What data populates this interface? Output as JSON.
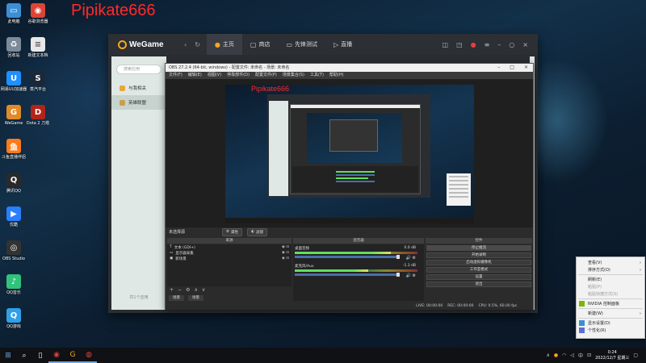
{
  "watermark": "Pipikate666",
  "desktop_icons": [
    {
      "label": "此电脑",
      "icon": "computer-icon",
      "color": "#3b8fd6"
    },
    {
      "label": "回收站",
      "icon": "recycle-bin-icon",
      "color": "#7c8a99"
    },
    {
      "label": "网易UU加速器",
      "icon": "uu-accelerator-icon",
      "color": "#1e90ff"
    },
    {
      "label": "WeGame",
      "icon": "wegame-icon",
      "color": "#e08a2a"
    },
    {
      "label": "斗鱼直播伴侣",
      "icon": "douyu-icon",
      "color": "#ff7a1a"
    },
    {
      "label": "腾讯QQ",
      "icon": "qq-icon",
      "color": "#2a2a2a"
    },
    {
      "label": "优酷",
      "icon": "youku-icon",
      "color": "#2a7fff"
    },
    {
      "label": "OBS Studio",
      "icon": "obs-icon",
      "color": "#333333"
    },
    {
      "label": "QQ音乐",
      "icon": "qq-music-icon",
      "color": "#31c27c"
    },
    {
      "label": "QQ游戏",
      "icon": "qq-game-icon",
      "color": "#2fa0e8"
    },
    {
      "label": "谷歌浏览器",
      "icon": "chrome-icon",
      "color": "#db4437"
    },
    {
      "label": "新建文本档",
      "icon": "text-file-icon",
      "color": "#e8e8e8"
    },
    {
      "label": "蒸汽平台",
      "icon": "steam-icon",
      "color": "#1b2838"
    },
    {
      "label": "Dota 2 刀塔",
      "icon": "dota2-icon",
      "color": "#b32418"
    }
  ],
  "wegame": {
    "logo": "WeGame",
    "tabs": [
      {
        "label": "主页",
        "icon": "home-icon"
      },
      {
        "label": "商店",
        "icon": "store-icon"
      },
      {
        "label": "先锋测试",
        "icon": "test-icon"
      },
      {
        "label": "直播",
        "icon": "live-icon"
      }
    ],
    "search_placeholder": "搜索应用",
    "side_items": [
      "与我相关",
      "英雄联盟"
    ],
    "side_bottom": "共1个应用"
  },
  "obs": {
    "title": "OBS 27.2.4 (64-bit, windows) - 配置文件: 未命名 - 场景: 未命名",
    "menu": [
      "文件(F)",
      "编辑(E)",
      "视图(V)",
      "停靠部件(D)",
      "配置文件(P)",
      "场景集合(S)",
      "工具(T)",
      "帮助(H)"
    ],
    "scene_label": "未选择源",
    "props_btn": "属性",
    "filters_btn": "滤镜",
    "sources_header": "来源",
    "sources": [
      {
        "glyph": "T",
        "name": "文本 (GDI+)"
      },
      {
        "glyph": "▭",
        "name": "显示器采集"
      },
      {
        "glyph": "▣",
        "name": "新场景"
      }
    ],
    "mixer_header": "混音器",
    "mixer": [
      {
        "name": "桌面音频",
        "db": "0.0 dB",
        "level": 0.78
      },
      {
        "name": "麦克风/Aux",
        "db": "-1.3 dB",
        "level": 0.6
      }
    ],
    "controls_header": "控件",
    "controls": [
      "停止推流",
      "开始录制",
      "启动虚拟摄像机",
      "工作室模式",
      "设置",
      "退出"
    ],
    "dock_tabs": [
      "场景",
      "场景"
    ],
    "transitions_tab": "转场特效",
    "mixer_tab": "混音器",
    "status": {
      "live": "LIVE: 00:00:00",
      "rec": "REC: 00:00:00",
      "cpu": "CPU: 0.5%, 60.00 fps"
    }
  },
  "context_menu": [
    {
      "label": "查看(V)",
      "disabled": false,
      "arrow": true
    },
    {
      "label": "排序方式(O)",
      "disabled": false,
      "arrow": true
    },
    {
      "label": "刷新(E)",
      "disabled": false,
      "arrow": false
    },
    {
      "label": "粘贴(P)",
      "disabled": true,
      "arrow": false
    },
    {
      "label": "粘贴快捷方式(S)",
      "disabled": true,
      "arrow": false
    },
    {
      "label": "NVIDIA 控制面板",
      "disabled": false,
      "arrow": false
    },
    {
      "label": "新建(W)",
      "disabled": false,
      "arrow": true
    },
    {
      "label": "显示设置(D)",
      "disabled": false,
      "arrow": false
    },
    {
      "label": "个性化(R)",
      "disabled": false,
      "arrow": false
    }
  ],
  "taskbar": {
    "time": "0:24",
    "date": "2022/12/7 星期三",
    "ime": "中"
  }
}
